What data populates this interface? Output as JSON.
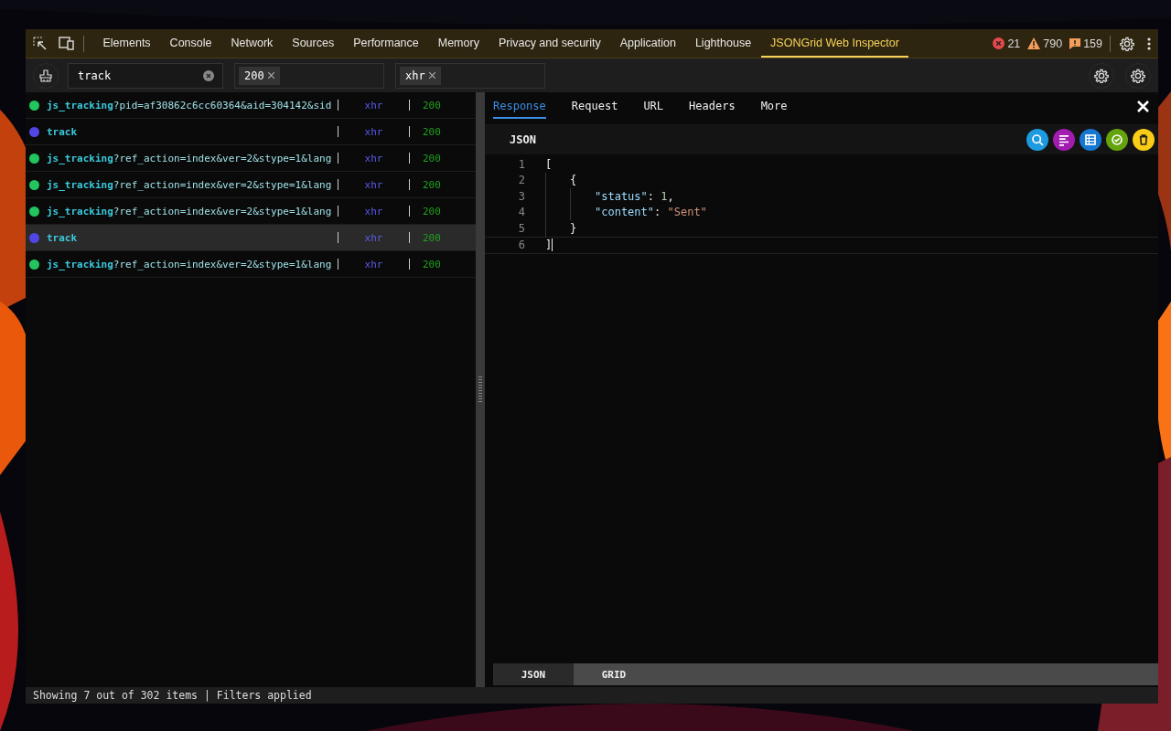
{
  "toolbar": {
    "tabs": [
      {
        "label": "Elements",
        "selected": false
      },
      {
        "label": "Console",
        "selected": false
      },
      {
        "label": "Network",
        "selected": false
      },
      {
        "label": "Sources",
        "selected": false
      },
      {
        "label": "Performance",
        "selected": false
      },
      {
        "label": "Memory",
        "selected": false
      },
      {
        "label": "Privacy and security",
        "selected": false
      },
      {
        "label": "Application",
        "selected": false
      },
      {
        "label": "Lighthouse",
        "selected": false
      },
      {
        "label": "JSONGrid Web Inspector",
        "selected": true
      }
    ],
    "counts": [
      {
        "kind": "error",
        "value": "21"
      },
      {
        "kind": "warning",
        "value": "790"
      },
      {
        "kind": "issue",
        "value": "159"
      }
    ]
  },
  "filters": {
    "search": {
      "value": "track"
    },
    "chips": [
      {
        "value": "200"
      },
      {
        "value": "xhr"
      }
    ]
  },
  "requests": [
    {
      "path": "js_tracking",
      "query": "?pid=af30862c6cc60364&aid=304142&sid",
      "type": "xhr",
      "status": "200",
      "color": "#22c55e",
      "selected": false
    },
    {
      "path": "track",
      "type": "xhr",
      "status": "200",
      "color": "#4f46e5",
      "selected": false
    },
    {
      "path": "js_tracking",
      "query": "?ref_action=index&ver=2&stype=1&lang",
      "type": "xhr",
      "status": "200",
      "color": "#22c55e",
      "selected": false
    },
    {
      "path": "js_tracking",
      "query": "?ref_action=index&ver=2&stype=1&lang",
      "type": "xhr",
      "status": "200",
      "color": "#22c55e",
      "selected": false
    },
    {
      "path": "js_tracking",
      "query": "?ref_action=index&ver=2&stype=1&lang",
      "type": "xhr",
      "status": "200",
      "color": "#22c55e",
      "selected": false
    },
    {
      "path": "track",
      "type": "xhr",
      "status": "200",
      "color": "#4f46e5",
      "selected": true
    },
    {
      "path": "js_tracking",
      "query": "?ref_action=index&ver=2&stype=1&lang",
      "type": "xhr",
      "status": "200",
      "color": "#22c55e",
      "selected": false
    }
  ],
  "detail": {
    "tabs": [
      {
        "label": "Response",
        "selected": true
      },
      {
        "label": "Request",
        "selected": false
      },
      {
        "label": "URL",
        "selected": false
      },
      {
        "label": "Headers",
        "selected": false
      },
      {
        "label": "More",
        "selected": false
      }
    ],
    "title": "JSON",
    "actions": [
      {
        "kind": "search",
        "color": "#1e9be0"
      },
      {
        "kind": "format",
        "color": "#a21caf"
      },
      {
        "kind": "table",
        "color": "#1677d2"
      },
      {
        "kind": "validate",
        "color": "#65a30d"
      },
      {
        "kind": "delete",
        "color": "#facc15"
      }
    ],
    "lines": [
      {
        "number": "1",
        "tokens": [
          {
            "kind": "punct",
            "text": "["
          }
        ],
        "children": [
          {
            "number": "2",
            "tokens": [
              {
                "kind": "punct",
                "text": "{"
              }
            ],
            "children": [
              {
                "number": "3",
                "tokens": [
                  {
                    "kind": "key",
                    "text": "\"status\""
                  },
                  {
                    "kind": "punct",
                    "text": ": "
                  },
                  {
                    "kind": "number",
                    "text": "1"
                  },
                  {
                    "kind": "punct",
                    "text": ","
                  }
                ]
              },
              {
                "number": "4",
                "tokens": [
                  {
                    "kind": "key",
                    "text": "\"content\""
                  },
                  {
                    "kind": "punct",
                    "text": ": "
                  },
                  {
                    "kind": "string",
                    "text": "\"Sent\""
                  }
                ]
              }
            ]
          },
          {
            "number": "5",
            "tokens": [
              {
                "kind": "punct",
                "text": "}"
              }
            ]
          }
        ]
      },
      {
        "number": "6",
        "tokens": [
          {
            "kind": "punct",
            "text": "]"
          }
        ]
      }
    ],
    "view_tabs": [
      {
        "label": "JSON",
        "selected": true
      },
      {
        "label": "GRID",
        "selected": false
      }
    ]
  },
  "status_bar": "Showing 7 out of 302 items | Filters applied"
}
